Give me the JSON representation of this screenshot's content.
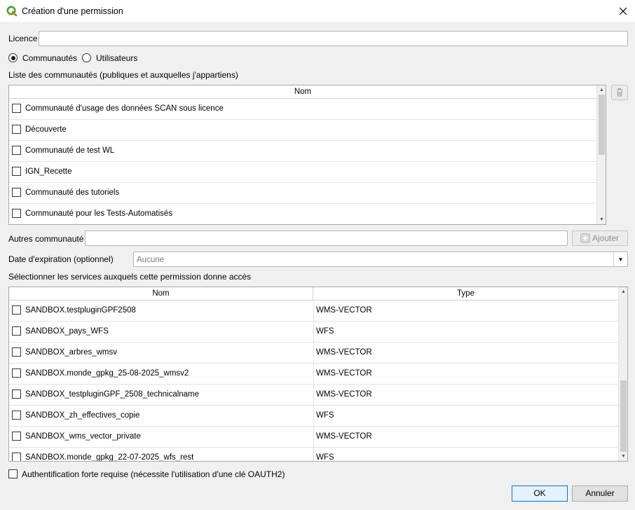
{
  "window": {
    "title": "Création d'une permission"
  },
  "form": {
    "licence_label": "Licence",
    "licence_value": "",
    "radio_communautes": "Communautés",
    "radio_utilisateurs": "Utilisateurs",
    "selected_radio": "Communautés",
    "communities_list_label": "Liste des communautés (publiques et auxquelles j'appartiens)",
    "communities_header": "Nom",
    "communities": [
      "Communauté d'usage des données SCAN sous licence",
      "Découverte",
      "Communauté de test WL",
      "IGN_Recette",
      "Communauté des tutoriels",
      "Communauté pour les Tests-Automatisés"
    ],
    "other_communities_label": "Autres communauté",
    "other_communities_value": "",
    "add_button": "Ajouter",
    "expiration_label": "Date d'expiration (optionnel)",
    "expiration_value": "Aucune",
    "services_label": "Sélectionner les services auxquels cette permission donne accès",
    "services_header_name": "Nom",
    "services_header_type": "Type",
    "services": [
      {
        "name": "SANDBOX.testpluginGPF2508",
        "type": "WMS-VECTOR"
      },
      {
        "name": "SANDBOX_pays_WFS",
        "type": "WFS"
      },
      {
        "name": "SANDBOX_arbres_wmsv",
        "type": "WMS-VECTOR"
      },
      {
        "name": "SANDBOX.monde_gpkg_25-08-2025_wmsv2",
        "type": "WMS-VECTOR"
      },
      {
        "name": "SANDBOX_testpluginGPF_2508_technicalname",
        "type": "WMS-VECTOR"
      },
      {
        "name": "SANDBOX_zh_effectives_copie",
        "type": "WFS"
      },
      {
        "name": "SANDBOX_wms_vector_private",
        "type": "WMS-VECTOR"
      },
      {
        "name": "SANDBOX.monde_gpkg_22-07-2025_wfs_rest",
        "type": "WFS"
      }
    ],
    "strong_auth_label": "Authentification forte requise (nécessite l'utilisation d'une clé OAUTH2)"
  },
  "buttons": {
    "ok": "OK",
    "cancel": "Annuler"
  },
  "icons": {
    "app": "qgis-logo-icon",
    "close": "close-icon",
    "delete": "trash-icon",
    "add": "plus-icon",
    "dropdown": "chevron-down-icon"
  },
  "colors": {
    "qgis_green": "#589632",
    "qgis_yellow": "#ee7913",
    "focus_blue": "#0078d7"
  }
}
